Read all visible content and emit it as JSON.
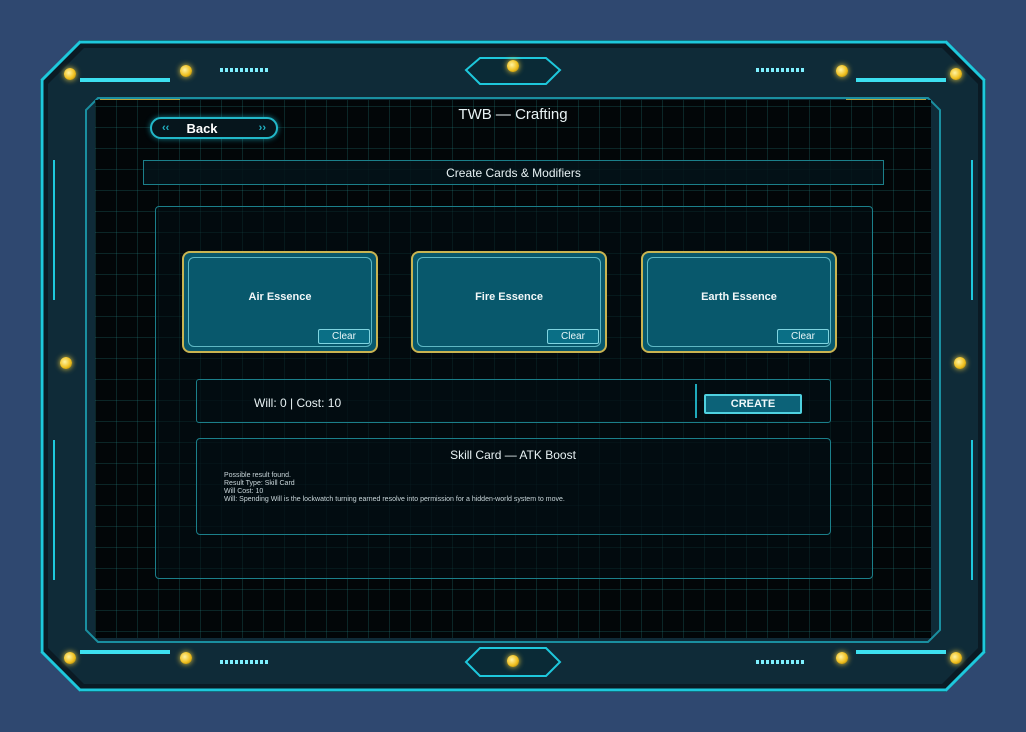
{
  "window": {
    "title": "TWB — Crafting"
  },
  "nav": {
    "back_label": "Back"
  },
  "header": {
    "title": "Create Cards & Modifiers"
  },
  "slots": [
    {
      "label": "Air Essence",
      "clear_label": "Clear"
    },
    {
      "label": "Fire Essence",
      "clear_label": "Clear"
    },
    {
      "label": "Earth Essence",
      "clear_label": "Clear"
    }
  ],
  "status": {
    "text": "Will: 0 | Cost: 10"
  },
  "actions": {
    "create_label": "CREATE"
  },
  "result": {
    "title": "Skill Card — ATK Boost",
    "lines": [
      "Possible result found.",
      "Result Type: Skill Card",
      "Will Cost: 10",
      "Will: Spending Will is the lockwatch turning earned resolve into permission for a hidden-world system to move."
    ]
  },
  "colors": {
    "background": "#2f4870",
    "accent": "#22b7c8",
    "slot_border": "#c9b451",
    "slot_fill": "#08586c"
  }
}
